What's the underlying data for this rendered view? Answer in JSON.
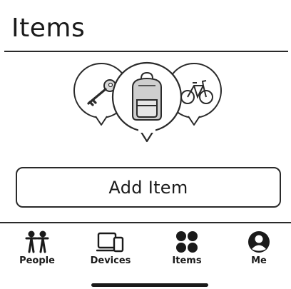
{
  "header": {
    "title": "Items"
  },
  "hero": {
    "items": [
      {
        "name": "key",
        "icon": "key-icon"
      },
      {
        "name": "backpack",
        "icon": "backpack-icon"
      },
      {
        "name": "bicycle",
        "icon": "bicycle-icon"
      }
    ]
  },
  "actions": {
    "add_item_label": "Add Item"
  },
  "tab_bar": {
    "tabs": [
      {
        "label": "People",
        "icon": "people-icon"
      },
      {
        "label": "Devices",
        "icon": "devices-icon"
      },
      {
        "label": "Items",
        "icon": "items-grid-icon",
        "selected": true
      },
      {
        "label": "Me",
        "icon": "person-circle-icon"
      }
    ]
  },
  "colors": {
    "ink": "#1a1a1a",
    "background": "#ffffff"
  }
}
